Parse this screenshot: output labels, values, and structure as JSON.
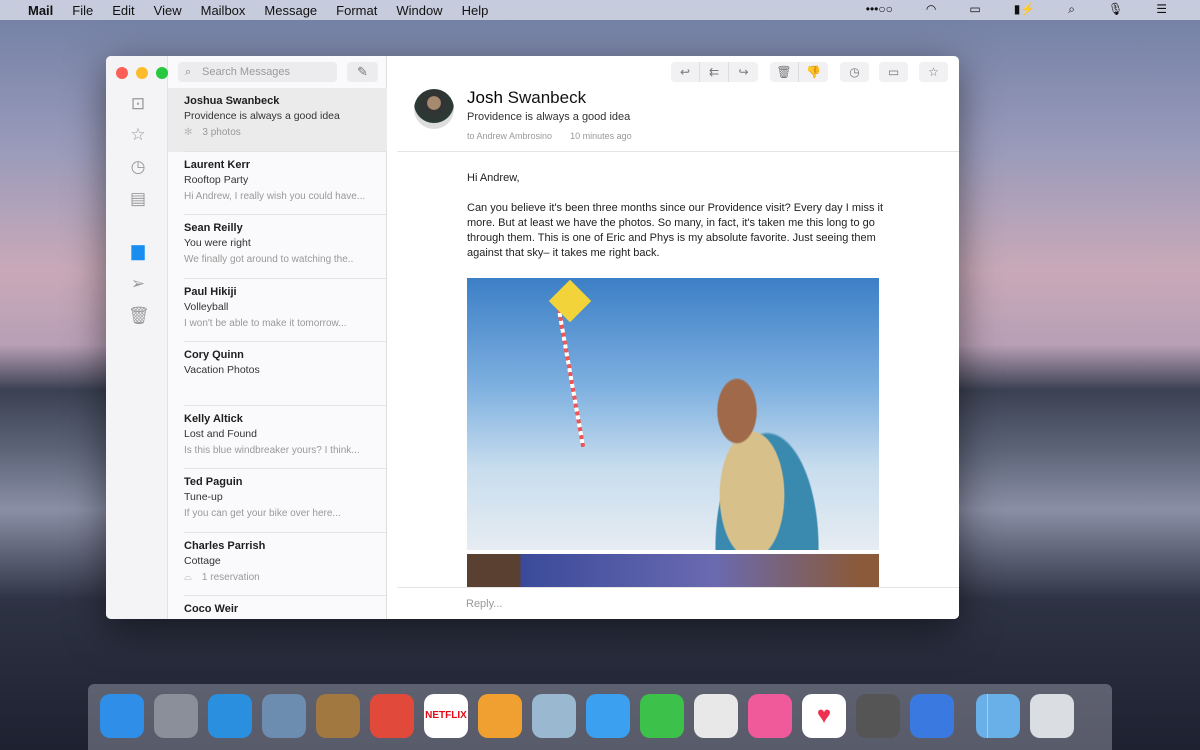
{
  "menubar": {
    "apple": "",
    "items": [
      "Mail",
      "File",
      "Edit",
      "View",
      "Mailbox",
      "Message",
      "Format",
      "Window",
      "Help"
    ],
    "status": [
      "•••○○",
      "wifi-icon",
      "airplay-icon",
      "battery-icon",
      "search-icon",
      "siri-icon",
      "notification-center-icon"
    ]
  },
  "search": {
    "placeholder": "Search Messages"
  },
  "sidebar": [
    "inbox-icon",
    "star-icon",
    "timer-icon",
    "document-icon",
    "archive-icon",
    "sent-icon",
    "trash-icon"
  ],
  "messages": [
    {
      "from": "Joshua Swanbeck",
      "subject": "Providence is always a good idea",
      "preview": "3 photos",
      "icon": "photos-icon"
    },
    {
      "from": "Laurent Kerr",
      "subject": "Rooftop Party",
      "preview": "Hi Andrew, I really wish you could have..."
    },
    {
      "from": "Sean Reilly",
      "subject": "You were right",
      "preview": "We finally got around to watching the.."
    },
    {
      "from": "Paul Hikiji",
      "subject": "Volleyball",
      "preview": "I won't be able to make it tomorrow..."
    },
    {
      "from": "Cory Quinn",
      "subject": "Vacation Photos",
      "preview": ""
    },
    {
      "from": "Kelly Altick",
      "subject": "Lost and Found",
      "preview": "Is this blue windbreaker yours? I think..."
    },
    {
      "from": "Ted Paguin",
      "subject": "Tune-up",
      "preview": "If you can get your bike over here..."
    },
    {
      "from": "Charles Parrish",
      "subject": "Cottage",
      "preview": "1 reservation",
      "icon": "sofa-icon"
    },
    {
      "from": "Coco Weir",
      "subject": "",
      "preview": ""
    }
  ],
  "email": {
    "first": "Josh",
    "last": "Swanbeck",
    "subject": "Providence is always a good idea",
    "to": "to Andrew Ambrosino",
    "time": "10 minutes ago",
    "greeting": "Hi Andrew,",
    "body": "Can you believe it's been three months since our Providence visit? Every day I miss it more. But at least we have the photos. So many, in fact, it's taken me this long to go through them. This is one of Eric and Phys is my absolute favorite. Just seeing them against that sky– it takes me right back.",
    "reply_placeholder": "Reply..."
  },
  "dock": [
    {
      "name": "finder",
      "color": "#2f8fe8"
    },
    {
      "name": "launchpad",
      "color": "#8a8f9a"
    },
    {
      "name": "safari",
      "color": "#2b8fe0"
    },
    {
      "name": "mail-stamp",
      "color": "#6d8db0"
    },
    {
      "name": "contacts",
      "color": "#a07840"
    },
    {
      "name": "calendar",
      "color": "#e14a3a"
    },
    {
      "name": "netflix",
      "color": "#ffffff",
      "label": "NETFLIX"
    },
    {
      "name": "pages",
      "color": "#f0a030"
    },
    {
      "name": "preview",
      "color": "#9ab8d0"
    },
    {
      "name": "messages",
      "color": "#3ba0f0"
    },
    {
      "name": "facetime",
      "color": "#3cc24a"
    },
    {
      "name": "news",
      "color": "#e8e8e8"
    },
    {
      "name": "itunes",
      "color": "#f05a9a"
    },
    {
      "name": "health",
      "color": "#ffffff"
    },
    {
      "name": "camera",
      "color": "#555555"
    },
    {
      "name": "airmail",
      "color": "#3a7ae0"
    },
    {
      "name": "downloads",
      "color": "#6ab0e8"
    },
    {
      "name": "trash",
      "color": "#dadde2"
    }
  ]
}
